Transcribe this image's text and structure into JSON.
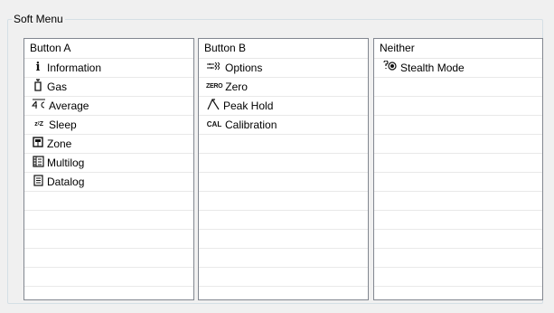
{
  "group": {
    "title": "Soft Menu"
  },
  "lists": [
    {
      "header": "Button A",
      "items": [
        {
          "icon": "information-icon",
          "glyph": "i",
          "label": "Information"
        },
        {
          "icon": "gas-icon",
          "glyph": "⍓",
          "label": "Gas"
        },
        {
          "icon": "average-icon",
          "glyph": "4͞c",
          "label": "Average"
        },
        {
          "icon": "sleep-icon",
          "glyph": "zᶻZ",
          "label": "Sleep"
        },
        {
          "icon": "zone-icon",
          "glyph": "▣",
          "label": "Zone"
        },
        {
          "icon": "multilog-icon",
          "glyph": "▥",
          "label": "Multilog"
        },
        {
          "icon": "datalog-icon",
          "glyph": "▤",
          "label": "Datalog"
        }
      ]
    },
    {
      "header": "Button B",
      "items": [
        {
          "icon": "options-icon",
          "glyph": "⚟≋",
          "label": "Options"
        },
        {
          "icon": "zero-icon",
          "glyph": "ZERO",
          "label": "Zero"
        },
        {
          "icon": "peak-hold-icon",
          "glyph": "/\\",
          "label": "Peak Hold"
        },
        {
          "icon": "calibration-icon",
          "glyph": "CAL",
          "label": "Calibration"
        }
      ]
    },
    {
      "header": "Neither",
      "items": [
        {
          "icon": "stealth-mode-icon",
          "glyph": "⚲◉",
          "label": "Stealth Mode"
        }
      ]
    }
  ]
}
